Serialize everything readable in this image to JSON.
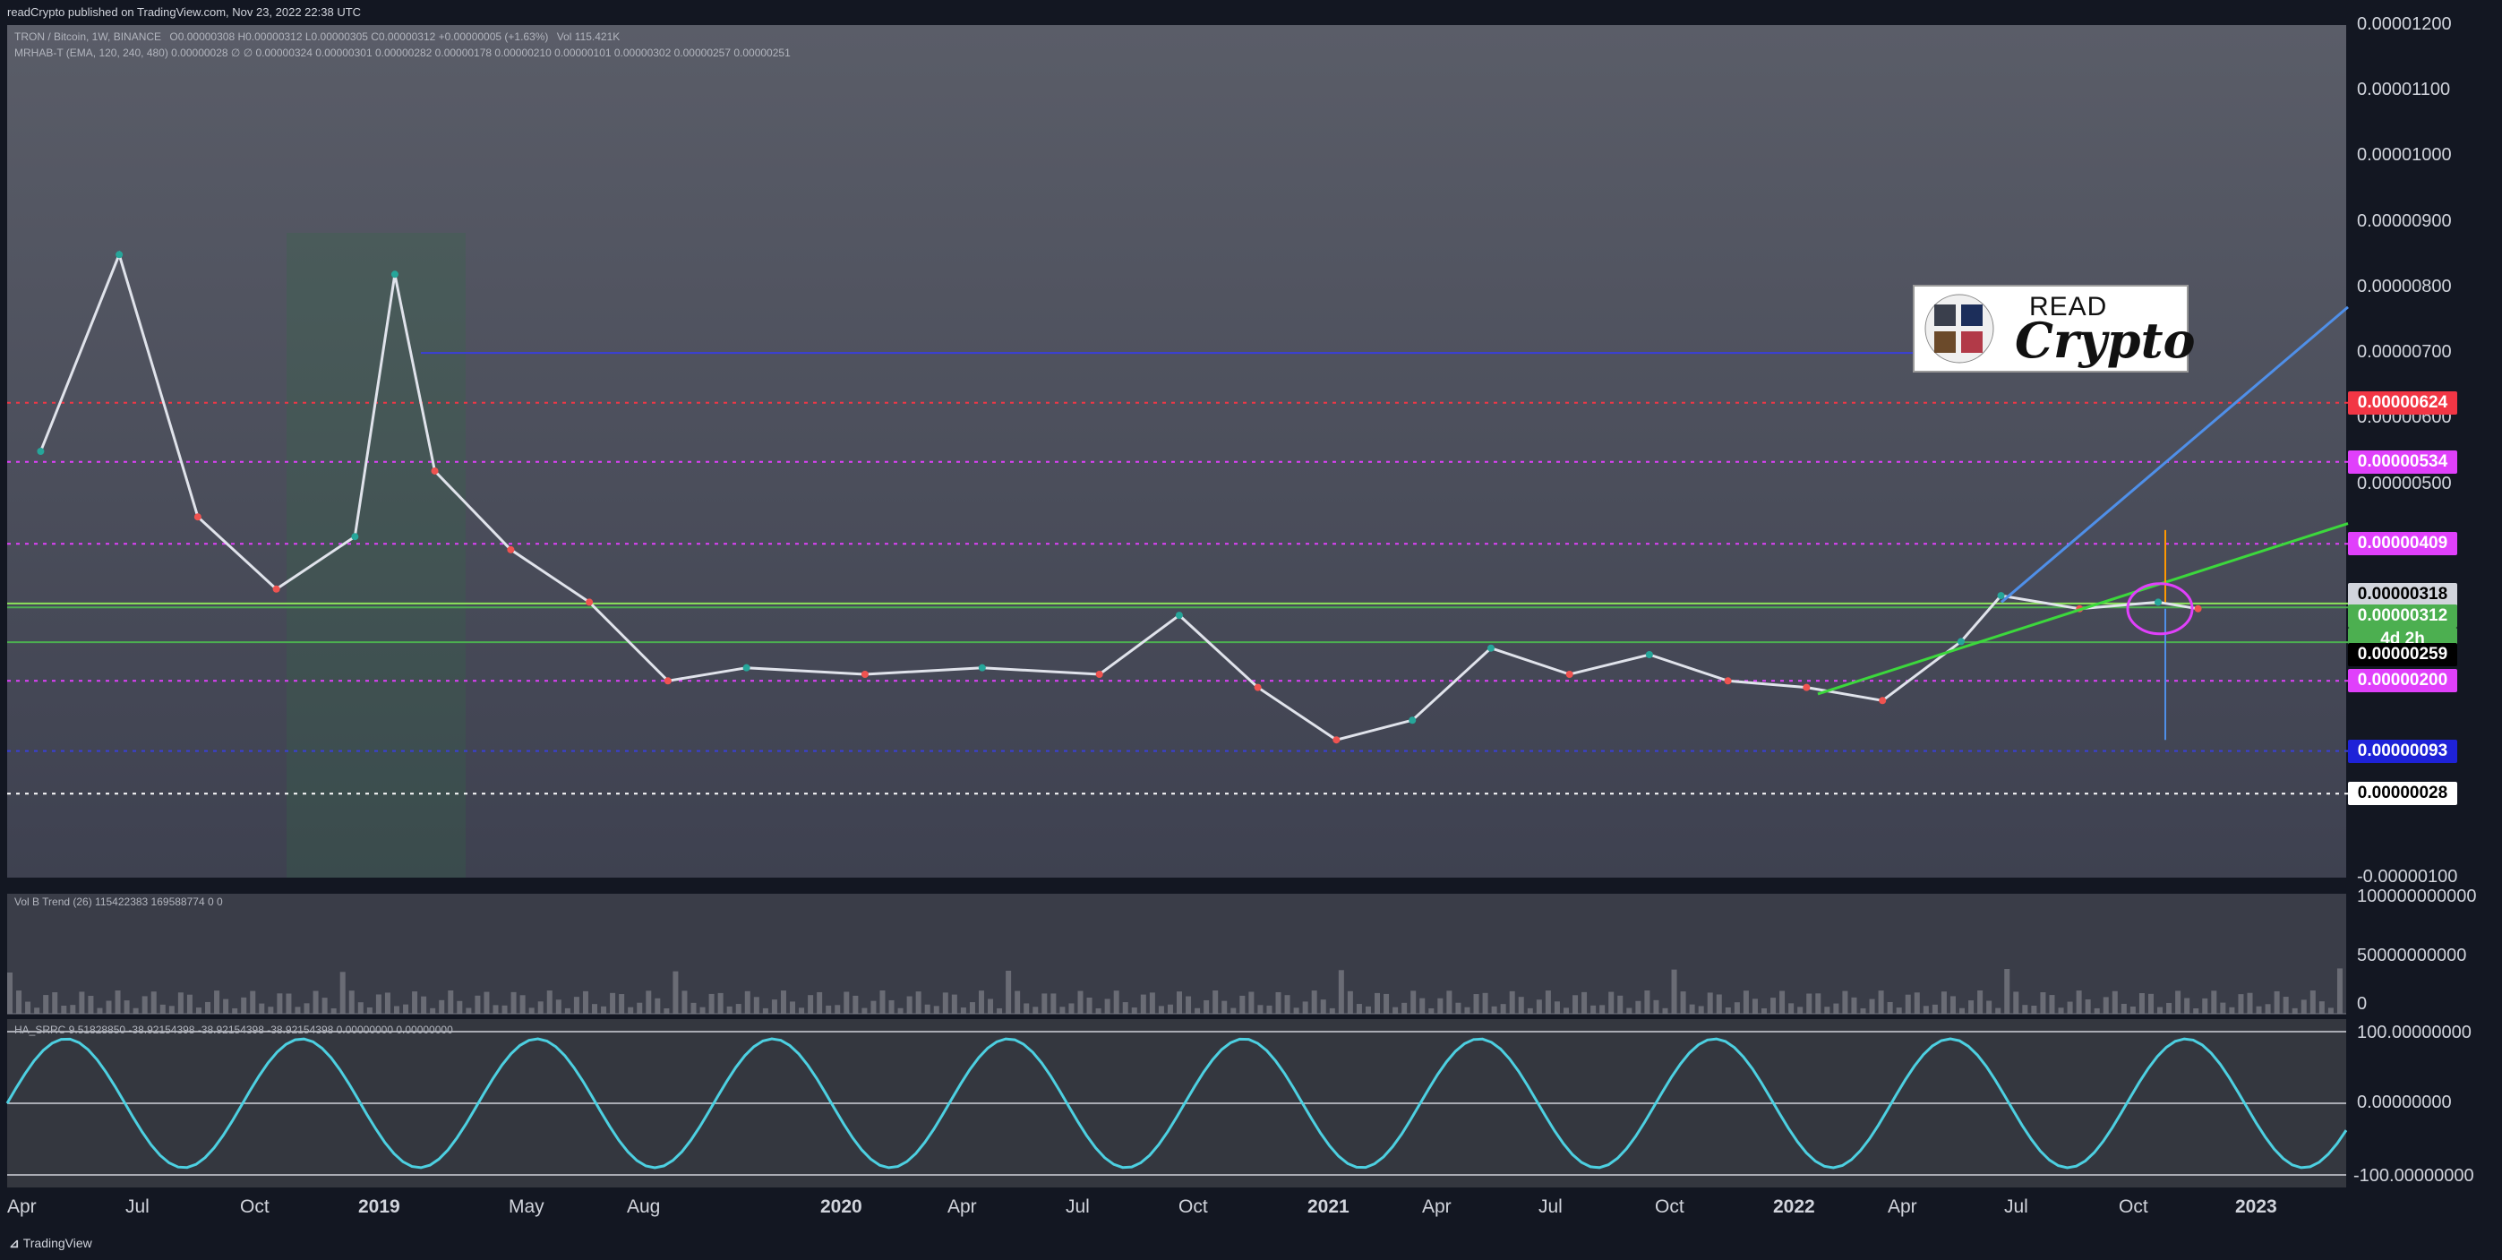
{
  "header": {
    "published": "readCrypto published on TradingView.com, Nov 23, 2022 22:38 UTC"
  },
  "legend_main": {
    "symbol": "TRON / Bitcoin, 1W, BINANCE",
    "ohlc": "O0.00000308  H0.00000312  L0.00000305  C0.00000312  +0.00000005 (+1.63%)",
    "vol": "Vol 115.421K",
    "indicator": "MRHAB-T (EMA, 120, 240, 480)  0.00000028  ∅  ∅  0.00000324  0.00000301  0.00000282  0.00000178  0.00000210  0.00000101  0.00000302  0.00000257  0.00000251"
  },
  "legend_vol": "Vol B Trend (26)  115422383  169588774  0  0",
  "legend_osc": "HA_SRRC  9.51828850  -38.92154398  -38.92154398  -38.92154398  0.00000000  0.00000000",
  "price_axis": {
    "ticks": [
      "0.00001200",
      "0.00001100",
      "0.00001000",
      "0.00000900",
      "0.00000800",
      "0.00000700",
      "0.00000600",
      "0.00000500",
      "-0.00000100"
    ]
  },
  "price_boxes": [
    {
      "label": "0.00000624",
      "bg": "#f23645",
      "fg": "#ffffff"
    },
    {
      "label": "0.00000534",
      "bg": "#e040fb",
      "fg": "#ffffff"
    },
    {
      "label": "0.00000409",
      "bg": "#e040fb",
      "fg": "#ffffff"
    },
    {
      "label": "0.00000318",
      "bg": "#d1d4dc",
      "fg": "#000000"
    },
    {
      "label": "0.00000312",
      "bg": "#4caf50",
      "fg": "#ffffff"
    },
    {
      "label": "4d 2h",
      "bg": "#4caf50",
      "fg": "#ffffff"
    },
    {
      "label": "0.00000259",
      "bg": "#000000",
      "fg": "#ffffff"
    },
    {
      "label": "0.00000200",
      "bg": "#e040fb",
      "fg": "#ffffff"
    },
    {
      "label": "0.00000093",
      "bg": "#1e22d8",
      "fg": "#ffffff"
    },
    {
      "label": "0.00000028",
      "bg": "#ffffff",
      "fg": "#000000"
    }
  ],
  "vol_axis": [
    "100000000000",
    "50000000000",
    "0"
  ],
  "osc_axis": [
    "100.00000000",
    "0.00000000",
    "-100.00000000"
  ],
  "time_axis": [
    "Apr",
    "Jul",
    "Oct",
    "2019",
    "May",
    "Aug",
    "2020",
    "Apr",
    "Jul",
    "Oct",
    "2021",
    "Apr",
    "Jul",
    "Oct",
    "2022",
    "Apr",
    "Jul",
    "Oct",
    "2023"
  ],
  "logo": {
    "read": "READ",
    "crypto": "Crypto"
  },
  "footer": "TradingView",
  "chart_data": {
    "type": "line",
    "title": "",
    "xlabel": "",
    "ylabel": "",
    "x": [
      "2018-04",
      "2018-06",
      "2018-08",
      "2018-10",
      "2018-12",
      "2019-01",
      "2019-02",
      "2019-04",
      "2019-06",
      "2019-08",
      "2019-10",
      "2020-01",
      "2020-04",
      "2020-07",
      "2020-09",
      "2020-11",
      "2021-01",
      "2021-03",
      "2021-05",
      "2021-07",
      "2021-09",
      "2021-11",
      "2022-01",
      "2022-03",
      "2022-05",
      "2022-06",
      "2022-08",
      "2022-10",
      "2022-11"
    ],
    "series": [
      {
        "values": [
          5.5e-06,
          8.5e-06,
          4.5e-06,
          3.4e-06,
          4.2e-06,
          8.2e-06,
          5.2e-06,
          4e-06,
          3.2e-06,
          2e-06,
          2.2e-06,
          2.1e-06,
          2.2e-06,
          2.1e-06,
          3e-06,
          1.9e-06,
          1.1e-06,
          1.4e-06,
          2.5e-06,
          2.1e-06,
          2.4e-06,
          2e-06,
          1.9e-06,
          1.7e-06,
          2.6e-06,
          3.3e-06,
          3.1e-06,
          3.2e-06,
          3.1e-06
        ]
      }
    ],
    "ylim": [
      -1e-06,
      1.2e-05
    ],
    "ohlc_last": {
      "open": 3.08e-06,
      "high": 3.12e-06,
      "low": 3.05e-06,
      "close": 3.12e-06
    },
    "horizontal_levels": [
      6.24e-06,
      5.34e-06,
      4.09e-06,
      3.18e-06,
      3.12e-06,
      2.59e-06,
      2e-06,
      9.3e-07,
      2.8e-07
    ],
    "volume_ylim": [
      0,
      100000000000
    ],
    "oscillator_ylim": [
      -100,
      100
    ]
  }
}
